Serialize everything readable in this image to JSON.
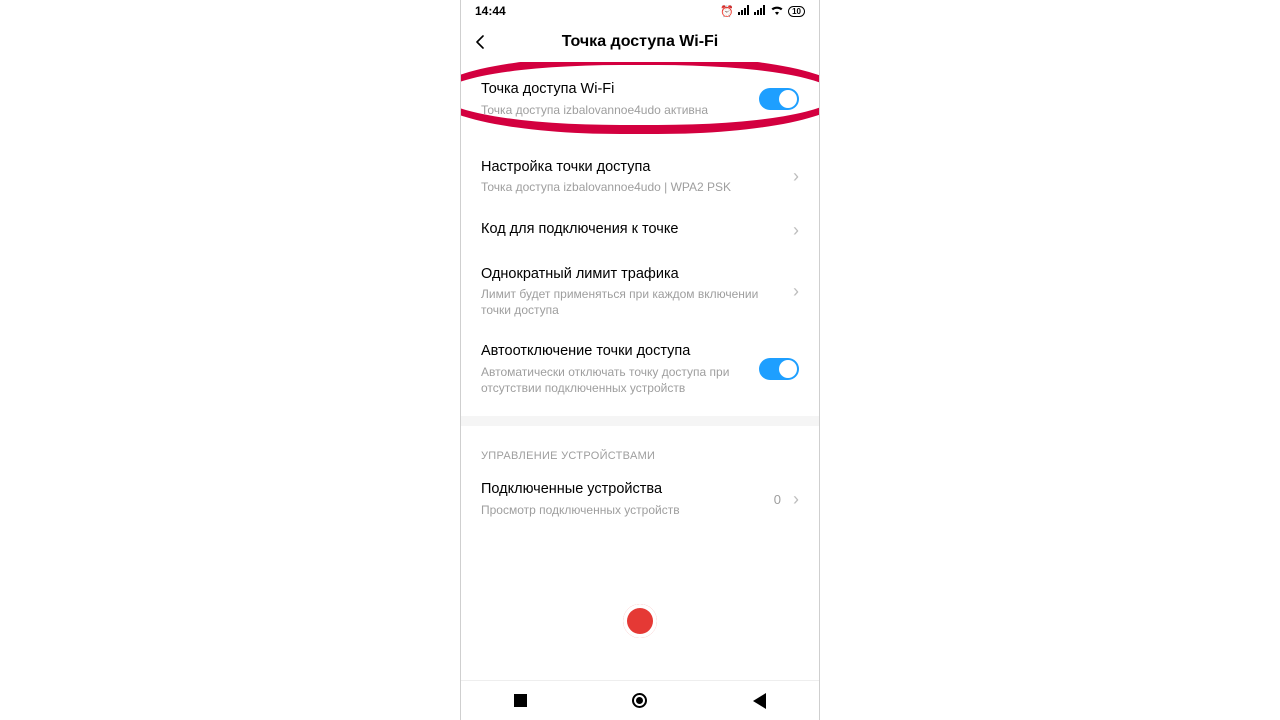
{
  "statusbar": {
    "time": "14:44",
    "battery": "10"
  },
  "header": {
    "title": "Точка доступа Wi-Fi"
  },
  "rows": {
    "hotspot": {
      "label": "Точка доступа Wi-Fi",
      "sub": "Точка доступа izbalovannoe4udo активна"
    },
    "setup": {
      "label": "Настройка точки доступа",
      "sub": "Точка доступа izbalovannoe4udo | WPA2 PSK"
    },
    "qr": {
      "label": "Код для подключения к точке"
    },
    "limit": {
      "label": "Однократный лимит трафика",
      "sub": "Лимит будет применяться при каждом включении точки доступа"
    },
    "auto_off": {
      "label": "Автоотключение точки доступа",
      "sub": "Автоматически отключать точку доступа при отсутствии подключенных устройств"
    }
  },
  "section": {
    "devices": "УПРАВЛЕНИЕ УСТРОЙСТВАМИ"
  },
  "devices_row": {
    "label": "Подключенные устройства",
    "sub": "Просмотр подключенных устройств",
    "count": "0"
  }
}
